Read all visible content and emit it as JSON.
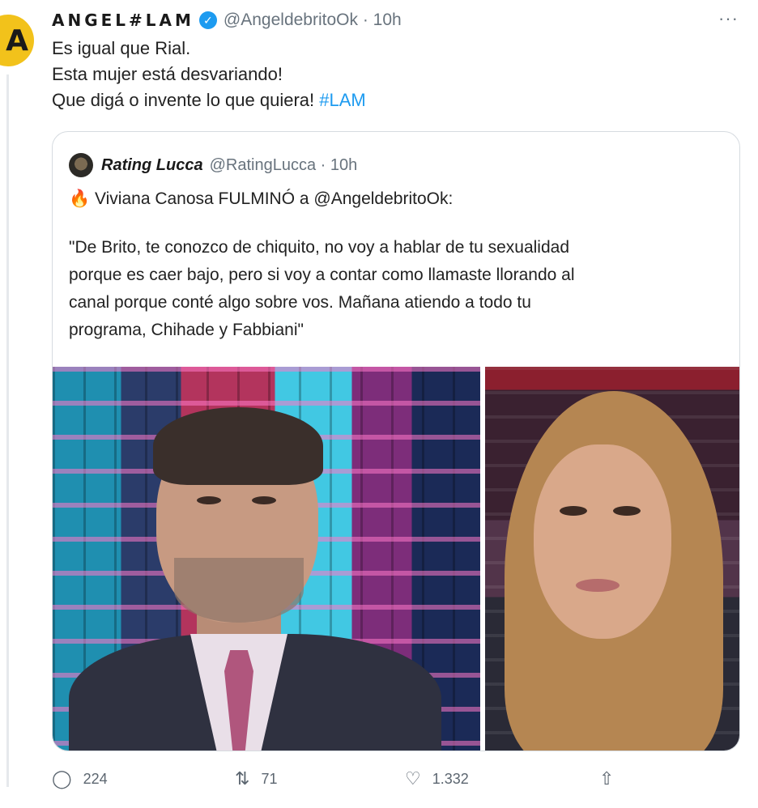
{
  "tweet": {
    "avatar_letter": "A",
    "author_name": "ANGEL#LAM",
    "handle": "@AngeldebritoOk · 10h",
    "more_label": "···",
    "lines": [
      "Es igual que Rial.",
      "Esta mujer está desvariando!",
      "Que digá o invente lo que quiera!"
    ],
    "hashtag": "#LAM"
  },
  "quote": {
    "author_name": "Rating Lucca",
    "handle": "@RatingLucca · 10h",
    "headline": "Viviana Canosa FULMINÓ a @AngeldebritoOk:",
    "quote_lines": [
      "\"De Brito, te conozco de chiquito, no voy a hablar de tu sexualidad",
      "porque es caer bajo, pero si voy a contar como llamaste llorando al",
      "canal porque conté algo sobre vos. Mañana atiendo a todo tu",
      "programa, Chihade y Fabbiani\""
    ]
  },
  "actions": {
    "reply_count": "224",
    "retweet_count": "71",
    "like_count": "1.332"
  },
  "icons": {
    "verified": "verified-badge-icon",
    "fire": "fire-icon",
    "reply": "reply-icon",
    "retweet": "retweet-icon",
    "like": "like-icon",
    "share": "share-icon"
  },
  "colors": {
    "link": "#1d9bf0",
    "avatar": "#f2c21b",
    "muted": "#68737d"
  }
}
